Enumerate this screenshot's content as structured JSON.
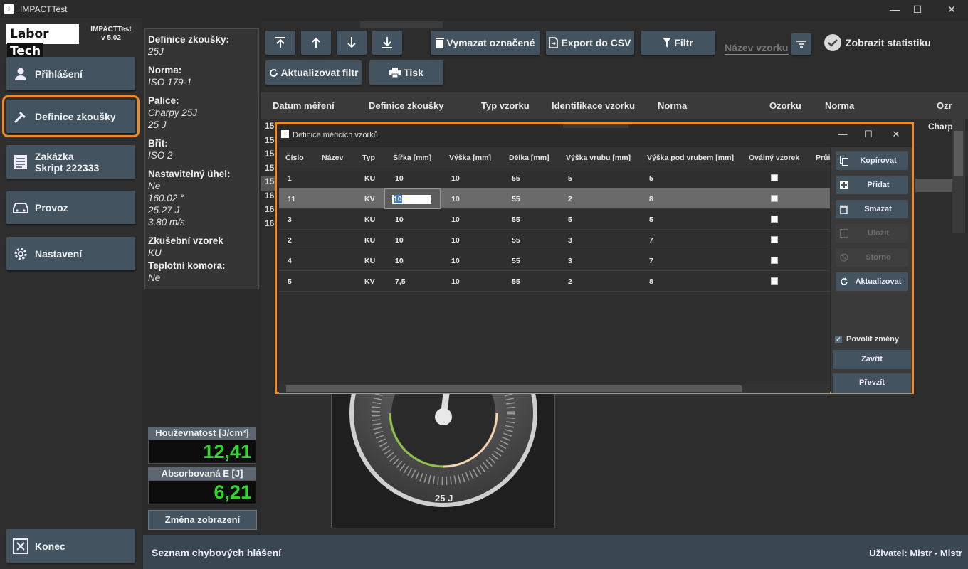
{
  "window": {
    "title": "IMPACTTest",
    "logo_part1": "Labor",
    "logo_part2": "Tech",
    "app_name": "IMPACTTest",
    "version": "v 5.02",
    "minimize": "—",
    "maximize": "☐",
    "close": "✕"
  },
  "nav": [
    {
      "label": "Přihlášení",
      "icon": "person-icon"
    },
    {
      "label": "Definice zkoušky",
      "icon": "hammer-icon"
    },
    {
      "label": "Zakázka",
      "sub": "Skript 222333",
      "icon": "document-icon"
    },
    {
      "label": "Provoz",
      "icon": "car-icon"
    },
    {
      "label": "Nastavení",
      "icon": "gear-icon"
    }
  ],
  "exit_label": "Konec",
  "info": [
    {
      "label": "Definice zkoušky:",
      "values": [
        "25J"
      ]
    },
    {
      "label": "Norma:",
      "values": [
        "ISO 179-1"
      ]
    },
    {
      "label": "Palice:",
      "values": [
        "Charpy 25J",
        "25 J"
      ]
    },
    {
      "label": "Břit:",
      "values": [
        "ISO 2"
      ]
    },
    {
      "label": "Nastavitelný úhel:",
      "values": [
        "Ne",
        "160.02 °",
        "25.27 J",
        "3.80 m/s"
      ]
    },
    {
      "label": "Zkušební vzorek",
      "values": [
        "KU"
      ]
    },
    {
      "label": "Teplotní komora:",
      "values": [
        "Ne"
      ]
    }
  ],
  "metrics": {
    "toughness_label": "Houževnatost [J/cm²]",
    "toughness_value": "12,41",
    "energy_label": "Absorbovaná E [J]",
    "energy_value": "6,21",
    "change_view": "Změna zobrazení"
  },
  "toolbar": {
    "delete_selected": "Vymazat označené",
    "export_csv": "Export do CSV",
    "filter": "Filtr",
    "search_placeholder": "Název vzorku",
    "show_stats": "Zobrazit statistiku",
    "refresh_filter": "Aktualizovat filtr",
    "print": "Tisk"
  },
  "grid": {
    "columns": [
      "Datum měření",
      "Definice zkoušky",
      "Typ vzorku",
      "Identifikace vzorku",
      "Norma",
      "Ozorku",
      "Norma",
      "Ozr"
    ],
    "row_prefixes": [
      "15",
      "15",
      "15",
      "15",
      "15",
      "16",
      "16",
      "16"
    ],
    "visible_cell": "Charp"
  },
  "gauge": {
    "label": "25 J"
  },
  "status": {
    "errors": "Seznam chybových hlášení",
    "user": "Uživatel: Mistr - Mistr"
  },
  "dialog": {
    "title": "Definice měřicích vzorků",
    "columns": [
      "Číslo",
      "Název",
      "Typ",
      "Šířka [mm]",
      "Výška [mm]",
      "Délka [mm]",
      "Výška vrubu [mm]",
      "Výška pod vrubem [mm]",
      "Oválný vzorek",
      "Průi"
    ],
    "rows": [
      {
        "cislo": "1",
        "typ": "KU",
        "sirka": "10",
        "vyska": "10",
        "delka": "55",
        "vyska_vrubu": "5",
        "pod_vrubem": "5"
      },
      {
        "cislo": "11",
        "typ": "KV",
        "sirka": "10",
        "vyska": "10",
        "delka": "55",
        "vyska_vrubu": "2",
        "pod_vrubem": "8",
        "selected": true
      },
      {
        "cislo": "3",
        "typ": "KU",
        "sirka": "10",
        "vyska": "10",
        "delka": "55",
        "vyska_vrubu": "5",
        "pod_vrubem": "5"
      },
      {
        "cislo": "2",
        "typ": "KU",
        "sirka": "10",
        "vyska": "10",
        "delka": "55",
        "vyska_vrubu": "3",
        "pod_vrubem": "7"
      },
      {
        "cislo": "4",
        "typ": "KU",
        "sirka": "10",
        "vyska": "10",
        "delka": "55",
        "vyska_vrubu": "3",
        "pod_vrubem": "7"
      },
      {
        "cislo": "5",
        "typ": "KV",
        "sirka": "7,5",
        "vyska": "10",
        "delka": "55",
        "vyska_vrubu": "2",
        "pod_vrubem": "8"
      }
    ],
    "buttons": {
      "copy": "Kopírovat",
      "add": "Přidat",
      "delete": "Smazat",
      "save": "Uložit",
      "cancel": "Storno",
      "refresh": "Aktualizovat"
    },
    "allow_changes": "Povolit změny",
    "close": "Zavřít",
    "take": "Převzít"
  },
  "colors": {
    "accent": "#f08a24",
    "button": "#43535f",
    "value_green": "#2ed72a"
  }
}
